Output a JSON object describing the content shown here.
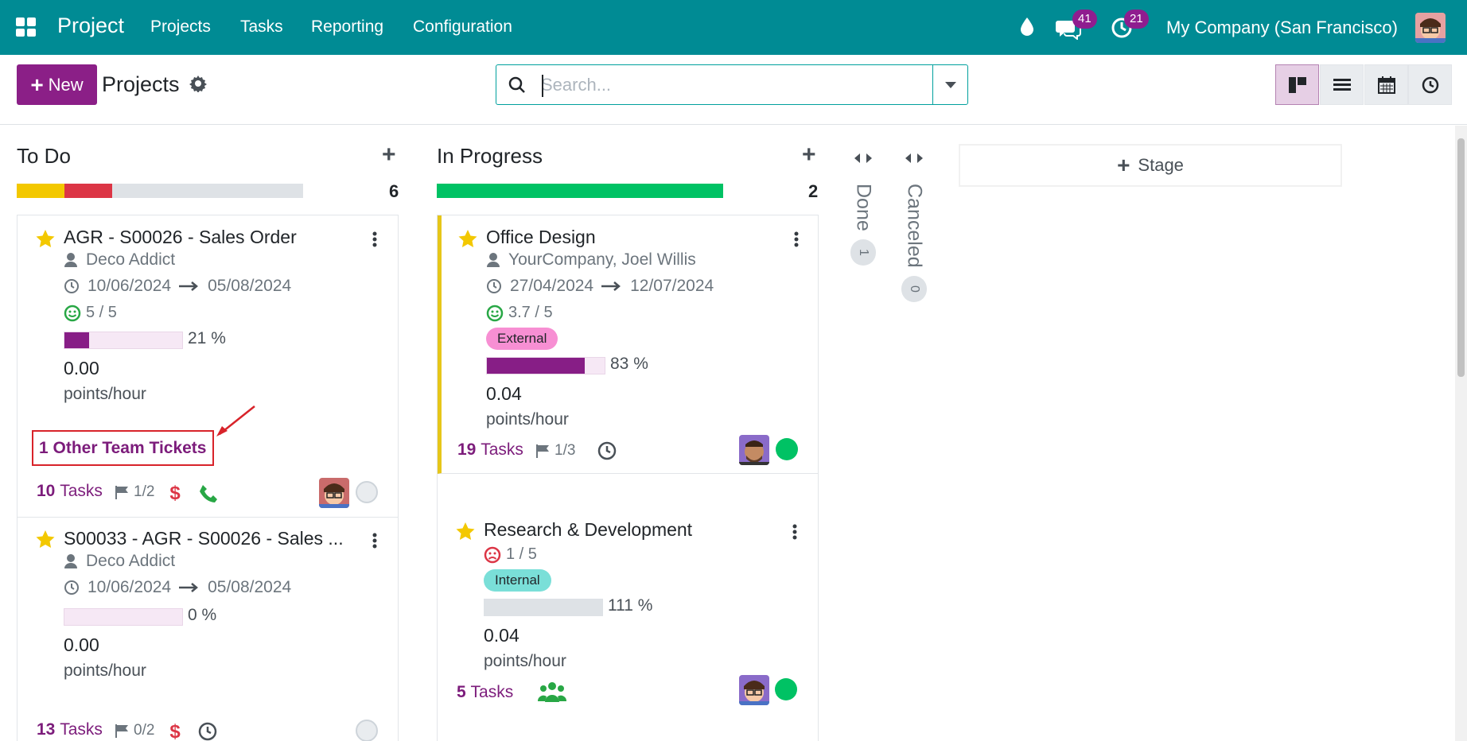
{
  "nav": {
    "brand": "Project",
    "menus": [
      "Projects",
      "Tasks",
      "Reporting",
      "Configuration"
    ],
    "chat_count": "41",
    "activity_count": "21",
    "company": "My Company (San Francisco)"
  },
  "control": {
    "new_label": "New",
    "title": "Projects",
    "search_placeholder": "Search..."
  },
  "columns": {
    "todo": {
      "title": "To Do",
      "count": "6",
      "progress": [
        {
          "color": "#f3c800",
          "fraction": 0.167
        },
        {
          "color": "#dc3545",
          "fraction": 0.167
        }
      ]
    },
    "inprogress": {
      "title": "In Progress",
      "count": "2",
      "progress": [
        {
          "color": "#00c264",
          "fraction": 1.0
        }
      ]
    },
    "done": {
      "title": "Done",
      "count": "1"
    },
    "canceled": {
      "title": "Canceled",
      "count": "0"
    }
  },
  "cards": {
    "c1": {
      "title": "AGR - S00026 - Sales Order",
      "customer": "Deco Addict",
      "date_start": "10/06/2024",
      "date_end": "05/08/2024",
      "rating": "5 / 5",
      "progress_pct": 21,
      "progress_label": "21 %",
      "value": "0.00",
      "unit": "points/hour",
      "other_tickets": "1 Other Team Tickets",
      "tasks_count": "10",
      "tasks_label": "Tasks",
      "milestones": "1/2"
    },
    "c2": {
      "title": "S00033 - AGR - S00026 - Sales ...",
      "customer": "Deco Addict",
      "date_start": "10/06/2024",
      "date_end": "05/08/2024",
      "progress_pct": 0,
      "progress_label": "0 %",
      "value": "0.00",
      "unit": "points/hour",
      "tasks_count": "13",
      "tasks_label": "Tasks",
      "milestones": "0/2"
    },
    "c3": {
      "title": "Office Design",
      "customer": "YourCompany, Joel Willis",
      "date_start": "27/04/2024",
      "date_end": "12/07/2024",
      "rating": "3.7 / 5",
      "tag": "External",
      "progress_pct": 83,
      "progress_label": "83 %",
      "value": "0.04",
      "unit": "points/hour",
      "tasks_count": "19",
      "tasks_label": "Tasks",
      "milestones": "1/3"
    },
    "c4": {
      "title": "Research & Development",
      "rating": "1 / 5",
      "tag": "Internal",
      "progress_pct": 111,
      "progress_label": "111 %",
      "value": "0.04",
      "unit": "points/hour",
      "tasks_count": "5",
      "tasks_label": "Tasks"
    }
  },
  "stage_button": "Stage",
  "colors": {
    "nav_bg": "#008b94",
    "primary": "#8b1f87",
    "status_green": "#00c264",
    "tag_external": "#f78fd3",
    "tag_internal": "#7adfd8"
  }
}
